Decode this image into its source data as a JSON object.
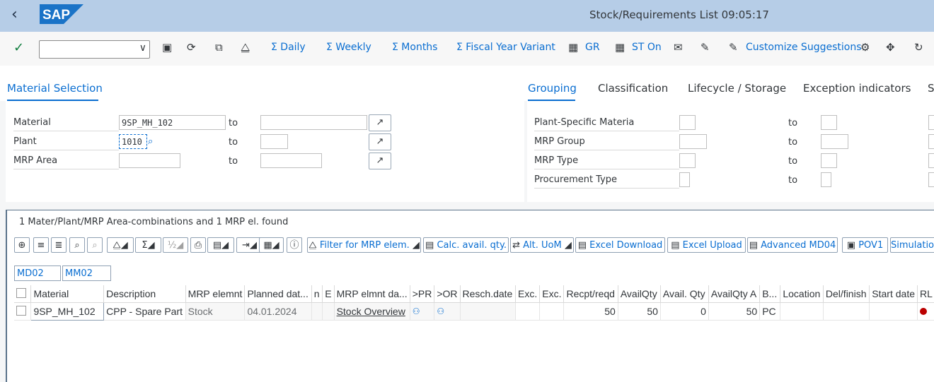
{
  "shell": {
    "title": "Stock/Requirements List 09:05:17",
    "logo_text": "SAP"
  },
  "toolbar": {
    "command_value": "",
    "buttons": [
      "Σ Daily",
      "Σ Weekly",
      "Σ Months",
      "Σ Fiscal Year Variant",
      "GR",
      "ST On",
      "Customize Suggestions"
    ]
  },
  "tabs": [
    "Material Selection",
    "Grouping",
    "Classification",
    "Lifecycle / Storage",
    "Exception indicators",
    "S"
  ],
  "selection": {
    "material_label": "Material",
    "material_value": "9SP_MH_102",
    "plant_label": "Plant",
    "plant_value": "1010",
    "mrp_area_label": "MRP Area",
    "to": "to"
  },
  "grouping": {
    "plant_specific_label": "Plant-Specific Materia",
    "mrp_group_label": "MRP Group",
    "mrp_type_label": "MRP Type",
    "procurement_type_label": "Procurement Type",
    "to": "to"
  },
  "alv": {
    "status": "1 Mater/Plant/MRP Area-combinations and 1 MRP el. found",
    "buttons": [
      "Filter for MRP elem.",
      "Calc. avail. qty.",
      "Alt. UoM",
      "Excel Download",
      "Excel Upload",
      "Advanced MD04",
      "POV1",
      "Simulation"
    ],
    "layouts": [
      "MD02",
      "MM02"
    ],
    "columns": [
      "Material",
      "Description",
      "MRP elemnt",
      "Planned dat...",
      "n",
      "E",
      "MRP elmnt da...",
      ">PR",
      ">OR",
      "Resch.date",
      "Exc.",
      "Exc.",
      "Recpt/reqd",
      "AvailQty",
      "Avail. Qty",
      "AvailQty A",
      "B...",
      "Location",
      "Del/finish",
      "Start date",
      "RL"
    ],
    "row": {
      "material": "9SP_MH_102",
      "description": "CPP - Spare Part",
      "mrp_element": "Stock",
      "planned_date": "04.01.2024",
      "mrp_element_data": "Stock Overview",
      "recpt_reqd": "50",
      "avail_qty": "50",
      "avail_qty2": "0",
      "avail_qty_a": "50",
      "base_unit": "PC"
    }
  }
}
